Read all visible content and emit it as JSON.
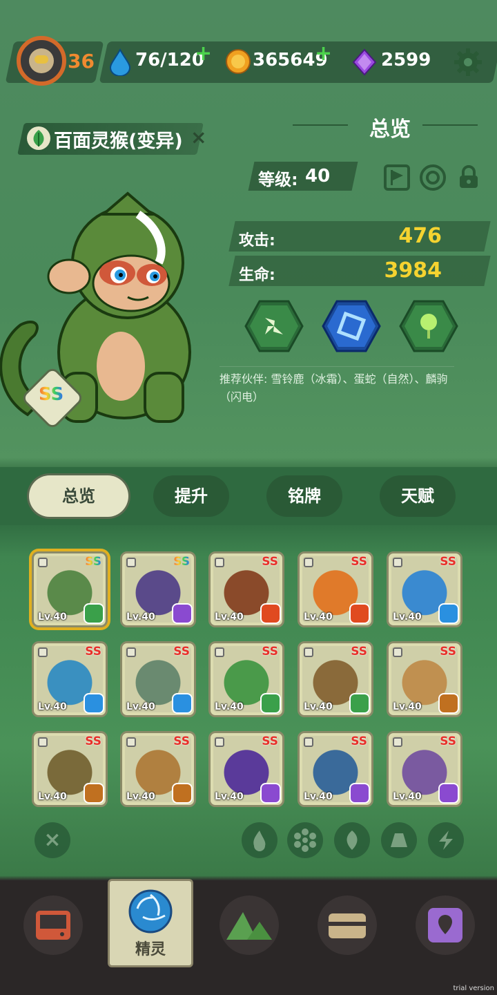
{
  "header": {
    "player_level": "36",
    "stamina": "76/120",
    "coins": "365649",
    "gems": "2599"
  },
  "creature": {
    "name": "百面灵猴(变异)",
    "rank": "SS"
  },
  "overview": {
    "title": "总览",
    "level_label": "等级:",
    "level_value": "40",
    "attack_label": "攻击:",
    "attack_value": "476",
    "hp_label": "生命:",
    "hp_value": "3984",
    "recommend": "推荐伙伴: 雪铃鹿（冰霜）、蛋蛇（自然）、麟驹（闪电）"
  },
  "tabs": [
    "总览",
    "提升",
    "铭牌",
    "天赋"
  ],
  "cards": [
    {
      "level": "Lv.40",
      "rank": "SS",
      "elem": "nature",
      "color": "#5a8a4a",
      "selected": true,
      "rainbow": true
    },
    {
      "level": "Lv.40",
      "rank": "SS",
      "elem": "lightning",
      "color": "#5a4a8a",
      "rainbow": true
    },
    {
      "level": "Lv.40",
      "rank": "SS",
      "elem": "fire",
      "color": "#8a4a2a"
    },
    {
      "level": "Lv.40",
      "rank": "SS",
      "elem": "fire",
      "color": "#e07a2a"
    },
    {
      "level": "Lv.40",
      "rank": "SS",
      "elem": "ice",
      "color": "#3a8ad0"
    },
    {
      "level": "Lv.40",
      "rank": "SS",
      "elem": "ice",
      "color": "#3a90c0"
    },
    {
      "level": "Lv.40",
      "rank": "SS",
      "elem": "ice",
      "color": "#6a8a70"
    },
    {
      "level": "Lv.40",
      "rank": "SS",
      "elem": "nature",
      "color": "#4a9a4a"
    },
    {
      "level": "Lv.40",
      "rank": "SS",
      "elem": "nature",
      "color": "#8a6a3a"
    },
    {
      "level": "Lv.40",
      "rank": "SS",
      "elem": "earth",
      "color": "#c09050"
    },
    {
      "level": "Lv.40",
      "rank": "SS",
      "elem": "earth",
      "color": "#7a6a3a"
    },
    {
      "level": "Lv.40",
      "rank": "SS",
      "elem": "earth",
      "color": "#b08040"
    },
    {
      "level": "Lv.40",
      "rank": "SS",
      "elem": "lightning",
      "color": "#5a3a9a"
    },
    {
      "level": "Lv.40",
      "rank": "SS",
      "elem": "lightning",
      "color": "#3a6a9a"
    },
    {
      "level": "Lv.40",
      "rank": "SS",
      "elem": "lightning",
      "color": "#7a5aa0"
    }
  ],
  "elem_colors": {
    "nature": "#3aa04a",
    "lightning": "#8a4ad0",
    "fire": "#e04a20",
    "ice": "#2a90e0",
    "earth": "#c07020"
  },
  "filters": [
    "close-icon",
    "fire-icon",
    "ice-icon",
    "leaf-icon",
    "earth-icon",
    "lightning-icon"
  ],
  "nav": {
    "active_label": "精灵"
  }
}
